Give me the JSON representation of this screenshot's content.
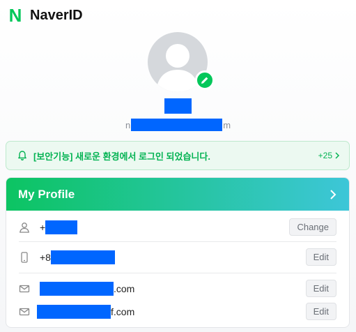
{
  "brand": "NaverID",
  "email_prefix": "n",
  "email_suffix": "m",
  "alert": {
    "text": "[보안기능] 새로운 환경에서 로그인 되었습니다.",
    "count": "+25"
  },
  "profile": {
    "title": "My Profile",
    "name_prefix": "+",
    "phone_prefix": "+8",
    "email1_suffix": ".com",
    "email2_suffix": "f.com",
    "change_label": "Change",
    "edit_label": "Edit"
  },
  "colors": {
    "accent": "#03c75a",
    "redaction": "#0066ff"
  }
}
